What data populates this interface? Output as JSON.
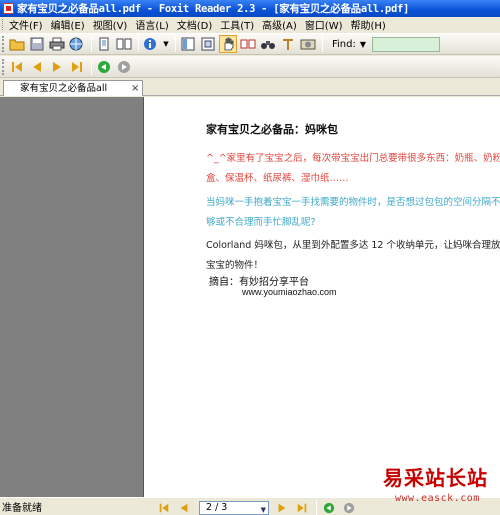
{
  "window": {
    "title": "家有宝贝之必备品all.pdf - Foxit Reader 2.3 - [家有宝贝之必备品all.pdf]"
  },
  "menu": {
    "items": [
      "文件(F)",
      "编辑(E)",
      "视图(V)",
      "语言(L)",
      "文档(D)",
      "工具(T)",
      "高级(A)",
      "窗口(W)",
      "帮助(H)"
    ]
  },
  "toolbar": {
    "find_label": "Find:"
  },
  "tab": {
    "label": "家有宝贝之必备品all"
  },
  "document": {
    "heading": "家有宝贝之必备品：妈咪包",
    "lines": [
      "^_^家里有了宝宝之后，每次带宝宝出门总要带很多东西：奶瓶、奶粉",
      "盒、保温杯、纸尿裤、湿巾纸……",
      "当妈咪一手抱着宝宝一手找需要的物件时，是否想过包包的空间分隔不",
      "够或不合理而手忙脚乱呢?",
      "Colorland 妈咪包，从里到外配置多达 12 个收纳单元，让妈咪合理放置",
      "宝宝的物件！"
    ],
    "source_label": "摘自：有妙招分享平台",
    "source_url": "www.youmiaozhao.com"
  },
  "status": {
    "text": "准备就绪",
    "page": "2 / 3"
  },
  "watermark": {
    "logo": "易采站长站",
    "url": "www.easck.com"
  }
}
